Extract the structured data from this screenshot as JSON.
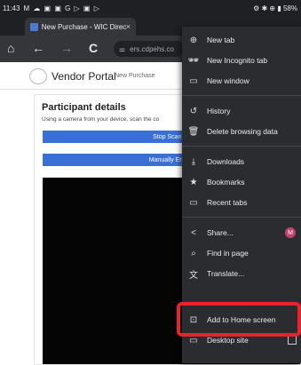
{
  "status_bar": {
    "time": "11:43",
    "left_icons": "M ☁ ▣ ▣ G ▷ ▣ ▷",
    "right_icons": "⚙ ✱ ⊕ ▮ 58%"
  },
  "tab": {
    "title": "New Purchase - WIC Direct V",
    "close": "×",
    "new_tab": "+"
  },
  "toolbar": {
    "home": "⌂",
    "back": "←",
    "forward": "→",
    "reload": "C",
    "tune": "⚌",
    "url": "ers.cdpehs.co"
  },
  "page": {
    "vendor": "Vendor Portal",
    "breadcrumb": "New Purchase",
    "title": "Participant details",
    "instructions": "Using a camera from your device, scan the co",
    "scan_button": "Stop Scannin",
    "manual_button": "Manually Enter I"
  },
  "menu": {
    "items": [
      {
        "icon": "⊕",
        "label": "New tab"
      },
      {
        "icon": "🕶",
        "label": "New Incognito tab"
      },
      {
        "icon": "▭",
        "label": "New window"
      },
      {
        "icon": "↺",
        "label": "History"
      },
      {
        "icon": "🗑",
        "label": "Delete browsing data"
      },
      {
        "icon": "⤓",
        "label": "Downloads"
      },
      {
        "icon": "★",
        "label": "Bookmarks"
      },
      {
        "icon": "▭",
        "label": "Recent tabs"
      },
      {
        "icon": "<",
        "label": "Share...",
        "badge": "M"
      },
      {
        "icon": "⌕",
        "label": "Find in page"
      },
      {
        "icon": "文",
        "label": "Translate..."
      },
      {
        "icon": "⊡",
        "label": "Add to Home screen"
      },
      {
        "icon": "▭",
        "label": "Desktop site"
      }
    ]
  },
  "colors": {
    "highlight": "#e8232b",
    "primary_button": "#3a6fd8",
    "menu_bg": "#2b2c30"
  }
}
